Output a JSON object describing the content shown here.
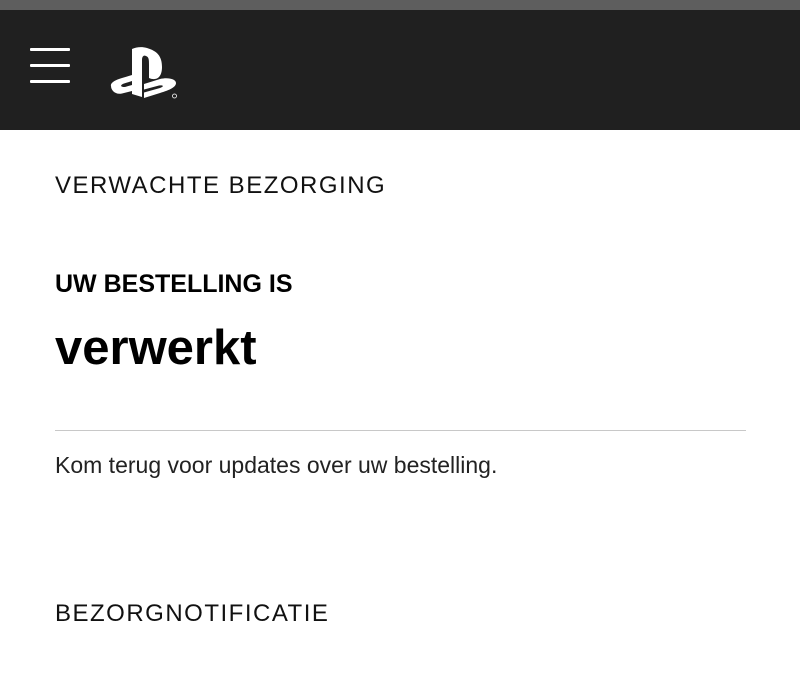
{
  "header": {
    "menu_icon": "hamburger-menu-icon",
    "logo_icon": "playstation-logo-icon",
    "background_color": "#202020"
  },
  "delivery": {
    "section_title": "VERWACHTE BEZORGING",
    "status_label": "UW BESTELLING IS",
    "status_value": "verwerkt",
    "message": "Kom terug voor updates over uw bestelling."
  },
  "notifications": {
    "section_title": "BEZORGNOTIFICATIE"
  }
}
